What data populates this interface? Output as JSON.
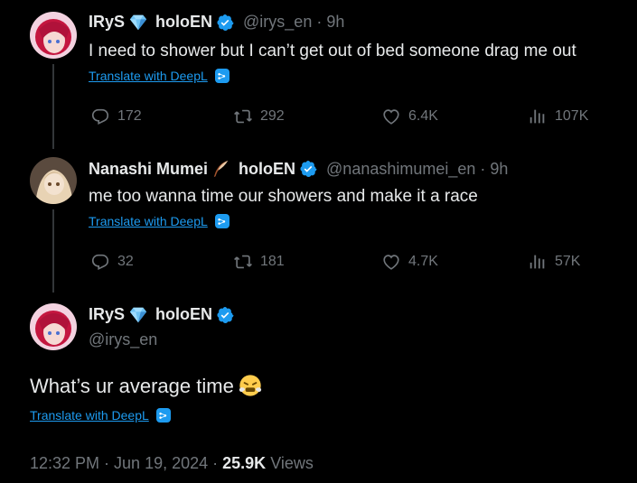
{
  "tweet1": {
    "name_part1": "IRyS",
    "name_part2": "holoEN",
    "handle_time": "@irys_en · 9h",
    "text": "I need to shower but I can’t get out of bed someone drag me out",
    "translate": "Translate with DeepL",
    "replies": "172",
    "reposts": "292",
    "likes": "6.4K",
    "views": "107K"
  },
  "tweet2": {
    "name_part1": "Nanashi Mumei",
    "name_part2": "holoEN",
    "handle_time": "@nanashimumei_en · 9h",
    "text": "me too wanna time our showers and make it a race",
    "translate": "Translate with DeepL",
    "replies": "32",
    "reposts": "181",
    "likes": "4.7K",
    "views": "57K"
  },
  "main_tweet": {
    "name_part1": "IRyS",
    "name_part2": "holoEN",
    "handle": "@irys_en",
    "text": "What’s ur average time",
    "translate": "Translate with DeepL",
    "timestamp": "12:32 PM · Jun 19, 2024 · ",
    "views_count": "25.9K",
    "views_label": "Views"
  },
  "colors": {
    "background": "#000000",
    "text": "#e7e9ea",
    "secondary": "#71767b",
    "link": "#1d9bf0",
    "verified": "#1d9bf0"
  }
}
